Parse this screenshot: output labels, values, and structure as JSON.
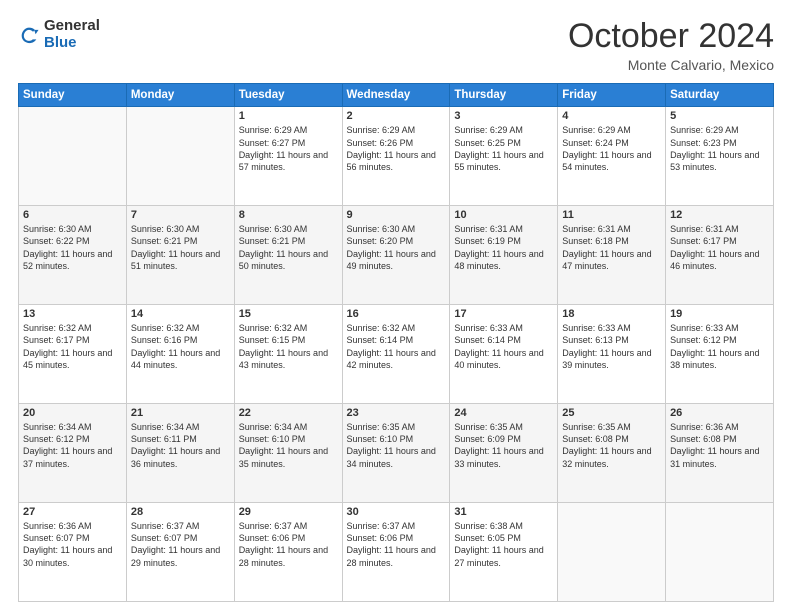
{
  "header": {
    "logo_general": "General",
    "logo_blue": "Blue",
    "month": "October 2024",
    "location": "Monte Calvario, Mexico"
  },
  "days_of_week": [
    "Sunday",
    "Monday",
    "Tuesday",
    "Wednesday",
    "Thursday",
    "Friday",
    "Saturday"
  ],
  "weeks": [
    [
      {
        "day": "",
        "info": ""
      },
      {
        "day": "",
        "info": ""
      },
      {
        "day": "1",
        "info": "Sunrise: 6:29 AM\nSunset: 6:27 PM\nDaylight: 11 hours and 57 minutes."
      },
      {
        "day": "2",
        "info": "Sunrise: 6:29 AM\nSunset: 6:26 PM\nDaylight: 11 hours and 56 minutes."
      },
      {
        "day": "3",
        "info": "Sunrise: 6:29 AM\nSunset: 6:25 PM\nDaylight: 11 hours and 55 minutes."
      },
      {
        "day": "4",
        "info": "Sunrise: 6:29 AM\nSunset: 6:24 PM\nDaylight: 11 hours and 54 minutes."
      },
      {
        "day": "5",
        "info": "Sunrise: 6:29 AM\nSunset: 6:23 PM\nDaylight: 11 hours and 53 minutes."
      }
    ],
    [
      {
        "day": "6",
        "info": "Sunrise: 6:30 AM\nSunset: 6:22 PM\nDaylight: 11 hours and 52 minutes."
      },
      {
        "day": "7",
        "info": "Sunrise: 6:30 AM\nSunset: 6:21 PM\nDaylight: 11 hours and 51 minutes."
      },
      {
        "day": "8",
        "info": "Sunrise: 6:30 AM\nSunset: 6:21 PM\nDaylight: 11 hours and 50 minutes."
      },
      {
        "day": "9",
        "info": "Sunrise: 6:30 AM\nSunset: 6:20 PM\nDaylight: 11 hours and 49 minutes."
      },
      {
        "day": "10",
        "info": "Sunrise: 6:31 AM\nSunset: 6:19 PM\nDaylight: 11 hours and 48 minutes."
      },
      {
        "day": "11",
        "info": "Sunrise: 6:31 AM\nSunset: 6:18 PM\nDaylight: 11 hours and 47 minutes."
      },
      {
        "day": "12",
        "info": "Sunrise: 6:31 AM\nSunset: 6:17 PM\nDaylight: 11 hours and 46 minutes."
      }
    ],
    [
      {
        "day": "13",
        "info": "Sunrise: 6:32 AM\nSunset: 6:17 PM\nDaylight: 11 hours and 45 minutes."
      },
      {
        "day": "14",
        "info": "Sunrise: 6:32 AM\nSunset: 6:16 PM\nDaylight: 11 hours and 44 minutes."
      },
      {
        "day": "15",
        "info": "Sunrise: 6:32 AM\nSunset: 6:15 PM\nDaylight: 11 hours and 43 minutes."
      },
      {
        "day": "16",
        "info": "Sunrise: 6:32 AM\nSunset: 6:14 PM\nDaylight: 11 hours and 42 minutes."
      },
      {
        "day": "17",
        "info": "Sunrise: 6:33 AM\nSunset: 6:14 PM\nDaylight: 11 hours and 40 minutes."
      },
      {
        "day": "18",
        "info": "Sunrise: 6:33 AM\nSunset: 6:13 PM\nDaylight: 11 hours and 39 minutes."
      },
      {
        "day": "19",
        "info": "Sunrise: 6:33 AM\nSunset: 6:12 PM\nDaylight: 11 hours and 38 minutes."
      }
    ],
    [
      {
        "day": "20",
        "info": "Sunrise: 6:34 AM\nSunset: 6:12 PM\nDaylight: 11 hours and 37 minutes."
      },
      {
        "day": "21",
        "info": "Sunrise: 6:34 AM\nSunset: 6:11 PM\nDaylight: 11 hours and 36 minutes."
      },
      {
        "day": "22",
        "info": "Sunrise: 6:34 AM\nSunset: 6:10 PM\nDaylight: 11 hours and 35 minutes."
      },
      {
        "day": "23",
        "info": "Sunrise: 6:35 AM\nSunset: 6:10 PM\nDaylight: 11 hours and 34 minutes."
      },
      {
        "day": "24",
        "info": "Sunrise: 6:35 AM\nSunset: 6:09 PM\nDaylight: 11 hours and 33 minutes."
      },
      {
        "day": "25",
        "info": "Sunrise: 6:35 AM\nSunset: 6:08 PM\nDaylight: 11 hours and 32 minutes."
      },
      {
        "day": "26",
        "info": "Sunrise: 6:36 AM\nSunset: 6:08 PM\nDaylight: 11 hours and 31 minutes."
      }
    ],
    [
      {
        "day": "27",
        "info": "Sunrise: 6:36 AM\nSunset: 6:07 PM\nDaylight: 11 hours and 30 minutes."
      },
      {
        "day": "28",
        "info": "Sunrise: 6:37 AM\nSunset: 6:07 PM\nDaylight: 11 hours and 29 minutes."
      },
      {
        "day": "29",
        "info": "Sunrise: 6:37 AM\nSunset: 6:06 PM\nDaylight: 11 hours and 28 minutes."
      },
      {
        "day": "30",
        "info": "Sunrise: 6:37 AM\nSunset: 6:06 PM\nDaylight: 11 hours and 28 minutes."
      },
      {
        "day": "31",
        "info": "Sunrise: 6:38 AM\nSunset: 6:05 PM\nDaylight: 11 hours and 27 minutes."
      },
      {
        "day": "",
        "info": ""
      },
      {
        "day": "",
        "info": ""
      }
    ]
  ]
}
